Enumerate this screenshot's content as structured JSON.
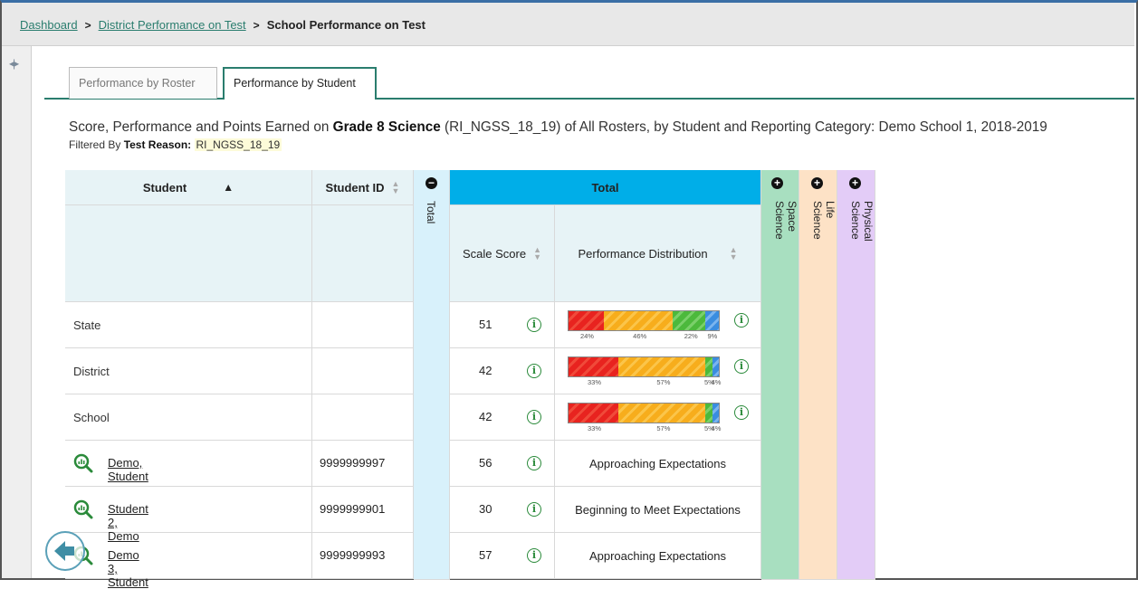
{
  "breadcrumb": {
    "items": [
      "Dashboard",
      "District Performance on Test"
    ],
    "current": "School Performance on Test"
  },
  "tabs": [
    "Performance by Roster",
    "Performance by Student"
  ],
  "title": {
    "prefix": "Score, Performance and Points Earned on ",
    "test": "Grade 8 Science",
    "suffix": " (RI_NGSS_18_19) of All Rosters, by Student and Reporting Category: Demo School 1, 2018-2019"
  },
  "filter": {
    "label": "Filtered By ",
    "key": "Test Reason:",
    "value": "RI_NGSS_18_19"
  },
  "table": {
    "col_student": "Student",
    "col_student_id": "Student ID",
    "col_total_collapsed": "Total",
    "col_total": "Total",
    "col_scale_score": "Scale Score",
    "col_perf_dist": "Performance Distribution",
    "col_earth": "Earth and Space Science",
    "col_life": "Life Science",
    "col_physical": "Physical Science",
    "agg_rows": [
      {
        "label": "State",
        "score": "51",
        "dist": [
          24,
          46,
          22,
          9
        ],
        "dist_labels": [
          "24%",
          "46%",
          "22%",
          "9%"
        ]
      },
      {
        "label": "District",
        "score": "42",
        "dist": [
          33,
          57,
          5,
          4
        ],
        "dist_labels": [
          "33%",
          "57%",
          "5%",
          "4%"
        ]
      },
      {
        "label": "School",
        "score": "42",
        "dist": [
          33,
          57,
          5,
          4
        ],
        "dist_labels": [
          "33%",
          "57%",
          "5%",
          "4%"
        ]
      }
    ],
    "students": [
      {
        "name": "Demo, Student",
        "id": "9999999997",
        "score": "56",
        "level": "Approaching Expectations"
      },
      {
        "name": "Student 2, Demo",
        "id": "9999999901",
        "score": "30",
        "level": "Beginning to Meet Expectations"
      },
      {
        "name": "Demo 3, Student",
        "id": "9999999993",
        "score": "57",
        "level": "Approaching Expectations"
      }
    ]
  },
  "colors": {
    "accent": "#2a7d6e",
    "total_header": "#00aee8",
    "total_col": "#d8f1fb",
    "earth": "#a8dfc0",
    "life": "#fde2c6",
    "physical": "#e3ccf7"
  }
}
